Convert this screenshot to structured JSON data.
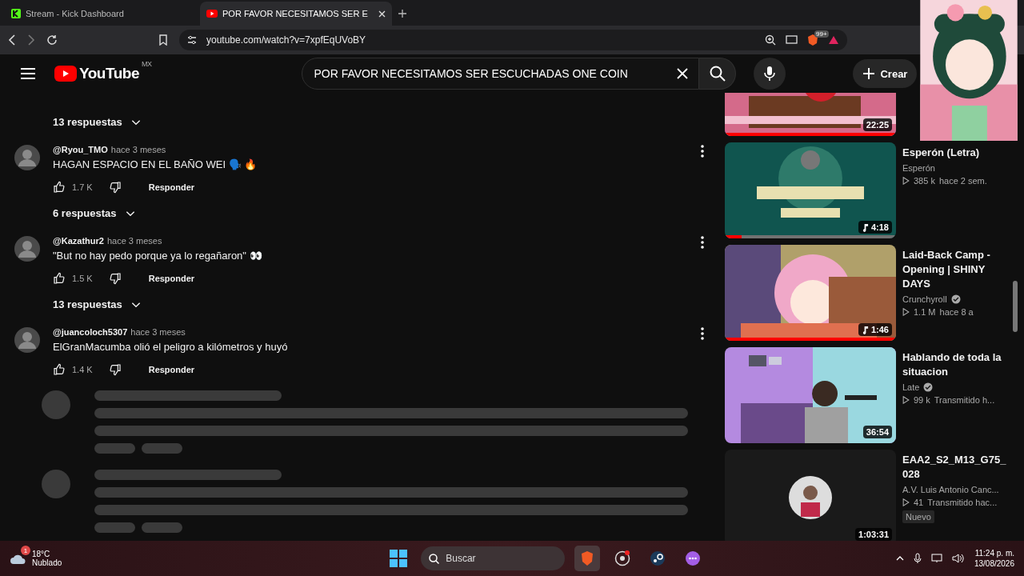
{
  "browser": {
    "tabs": [
      {
        "title": "Stream - Kick Dashboard",
        "kind": "kick",
        "selected": false
      },
      {
        "title": "POR FAVOR NECESITAMOS SER E",
        "kind": "youtube",
        "selected": true
      }
    ],
    "url": "youtube.com/watch?v=7xpfEqUVoBY",
    "shield_badge": "99+"
  },
  "header": {
    "logo": "YouTube",
    "region": "MX",
    "search": "POR FAVOR NECESITAMOS SER ESCUCHADAS ONE COIN",
    "create": "Crear"
  },
  "comments": [
    {
      "kind": "replies",
      "label": "13 respuestas"
    },
    {
      "kind": "comment",
      "author": "@Ryou_TMO",
      "time": "hace 3 meses",
      "text": "HAGAN ESPACIO EN EL BAÑO WEI 🗣️ 🔥",
      "likes": "1.7 K",
      "reply": "Responder"
    },
    {
      "kind": "replies",
      "label": "6 respuestas"
    },
    {
      "kind": "comment",
      "author": "@Kazathur2",
      "time": "hace 3 meses",
      "text": "\"But no hay pedo porque ya lo regañaron\" 👀",
      "likes": "1.5 K",
      "reply": "Responder"
    },
    {
      "kind": "replies",
      "label": "13 respuestas"
    },
    {
      "kind": "comment",
      "author": "@juancoloch5307",
      "time": "hace 3 meses",
      "text": "ElGranMacumba olió el peligro a kilómetros y huyó",
      "likes": "1.4 K",
      "reply": "Responder"
    },
    {
      "kind": "skeleton"
    },
    {
      "kind": "skeleton"
    }
  ],
  "related": [
    {
      "duration": "22:25",
      "music": false,
      "level": 1
    },
    {
      "title": "Esperón (Letra)",
      "channel": "Esperón",
      "verified": false,
      "views": "385 k",
      "age": "hace 2 sem.",
      "duration": "4:18",
      "music": true,
      "level": 0.1
    },
    {
      "title": "Laid-Back Camp - Opening | SHINY DAYS",
      "channel": "Crunchyroll",
      "verified": true,
      "views": "1.1 M",
      "age": "hace 8 a",
      "duration": "1:46",
      "music": true,
      "level": 1
    },
    {
      "title": "Hablando de toda la situacion",
      "channel": "Late",
      "verified": true,
      "views": "99 k",
      "age": "Transmitido h...",
      "duration": "36:54",
      "music": false
    },
    {
      "title": "EAA2_S2_M13_G75_ 028",
      "channel": "A.V. Luis Antonio Canc...",
      "verified": false,
      "views": "41",
      "age": "Transmitido hac...",
      "badge": "Nuevo",
      "duration": "1:03:31",
      "music": false
    }
  ],
  "taskbar": {
    "temperature": "18°C",
    "condition": "Nublado",
    "weather_badge": "1",
    "search": "Buscar",
    "time": "11:24 p. m.",
    "date": "13/08/2026"
  }
}
